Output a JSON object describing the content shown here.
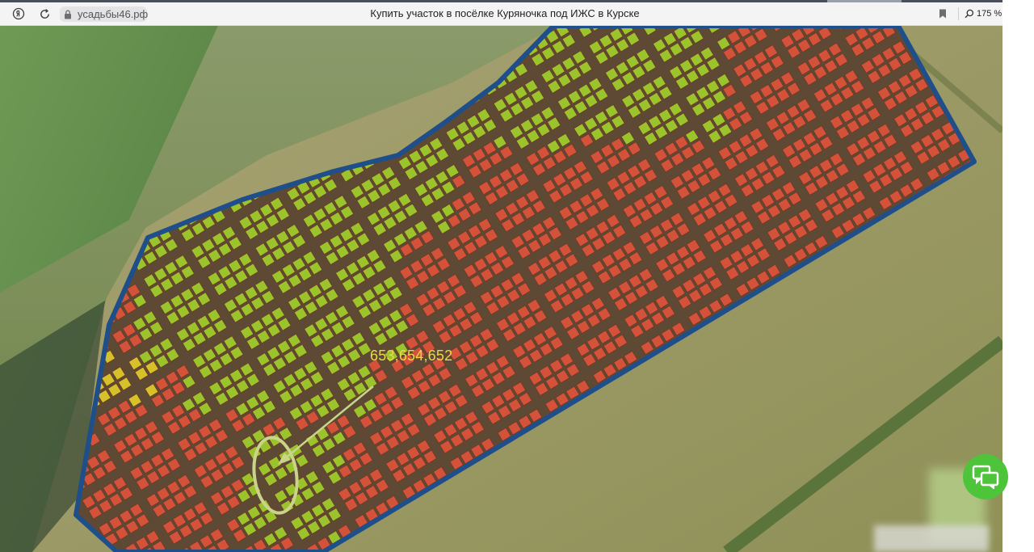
{
  "browser": {
    "domain": "усадьбы46.рф",
    "page_title": "Купить участок в посёлке Куряночка под ИЖС в Курске",
    "zoom_level": "175 %"
  },
  "map": {
    "plot_label": "653,654,652",
    "colors": {
      "available": "#9bc42c",
      "sold": "#d4523a",
      "reserved": "#d6c12a",
      "boundary": "#1f4f8a",
      "road": "#5e4a34",
      "highlight": "#c9d48a"
    }
  },
  "icons": [
    "yandex-icon",
    "reload-icon",
    "lock-icon",
    "bookmark-icon",
    "zoom-icon",
    "chat-icon"
  ]
}
